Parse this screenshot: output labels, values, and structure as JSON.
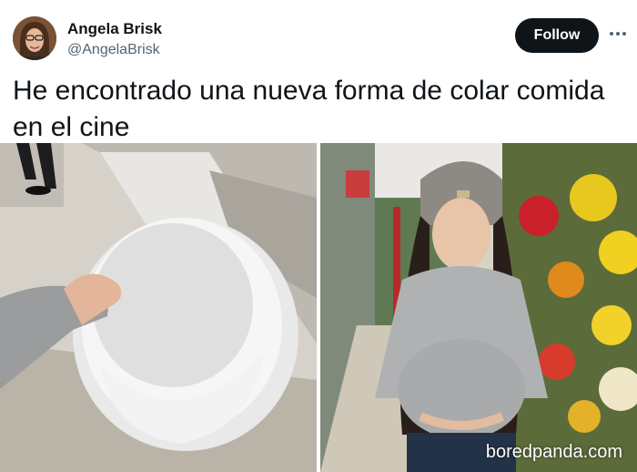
{
  "author": {
    "name": "Angela Brisk",
    "handle": "@AngelaBrisk",
    "avatar_icon": "profile-photo"
  },
  "actions": {
    "follow_label": "Follow",
    "more_icon": "more-options-icon"
  },
  "tweet": {
    "text": "He encontrado una nueva forma de colar comida en el cine"
  },
  "media": {
    "left_image": "hand-holding-styrofoam-half-sphere",
    "right_image": "woman-with-round-belly-in-flower-aisle",
    "watermark": "boredpanda.com"
  },
  "colors": {
    "follow_button": "#0f1419",
    "handle_text": "#536471"
  }
}
